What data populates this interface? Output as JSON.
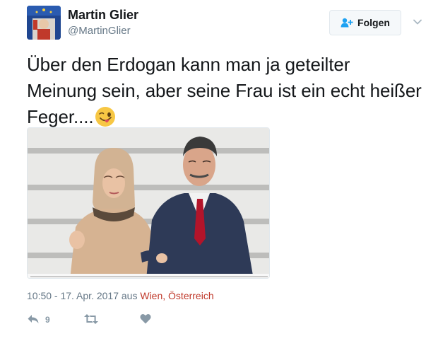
{
  "user": {
    "name": "Martin Glier",
    "handle": "@MartinGlier"
  },
  "follow_button": {
    "label": "Folgen",
    "icon": "add-user-icon"
  },
  "menu": {
    "icon": "chevron-down-icon"
  },
  "tweet": {
    "text": "Über den Erdogan kann man ja geteilter Meinung sein, aber seine Frau ist ein echt heißer Feger....",
    "emoji": "winking-face-with-tongue"
  },
  "meta": {
    "time": "10:50 - 17. Apr. 2017",
    "from_label": "aus",
    "location": "Wien, Österreich"
  },
  "actions": {
    "reply_count": "9",
    "retweet_count": "",
    "like_count": ""
  },
  "colors": {
    "text": "#14171a",
    "muted": "#657786",
    "icon": "#8899a6",
    "location": "#c0392b"
  }
}
